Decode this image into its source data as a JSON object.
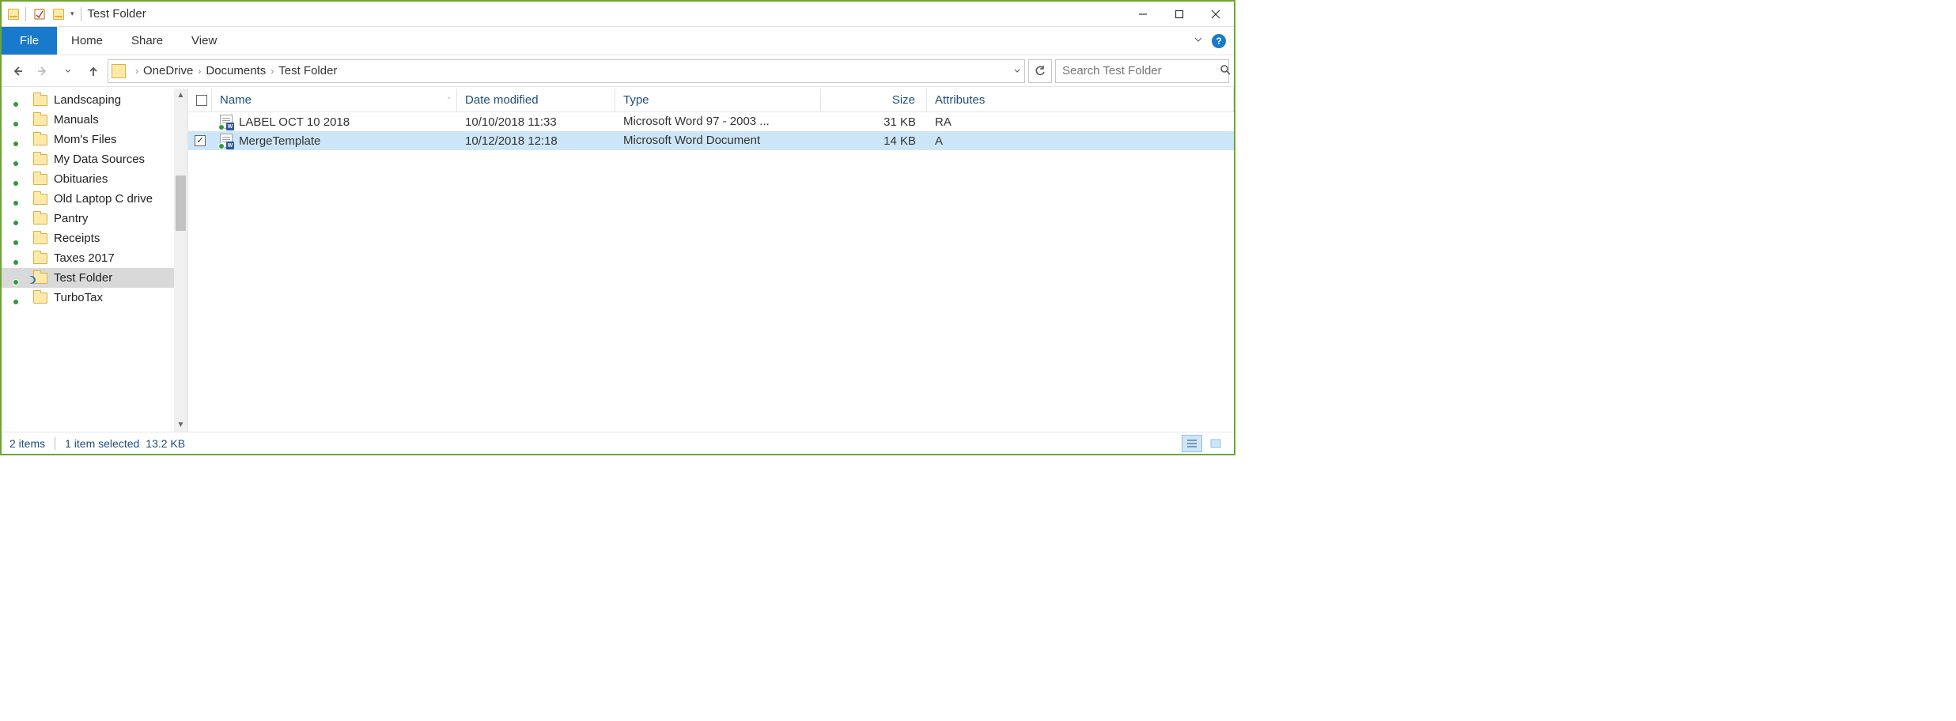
{
  "window": {
    "title": "Test Folder"
  },
  "ribbon": {
    "file": "File",
    "tabs": [
      "Home",
      "Share",
      "View"
    ]
  },
  "breadcrumbs": [
    "OneDrive",
    "Documents",
    "Test Folder"
  ],
  "search": {
    "placeholder": "Search Test Folder"
  },
  "sidebar": {
    "items": [
      "Landscaping",
      "Manuals",
      "Mom's Files",
      "My Data Sources",
      "Obituaries",
      "Old Laptop C drive",
      "Pantry",
      "Receipts",
      "Taxes 2017",
      "Test Folder",
      "TurboTax"
    ],
    "active_index": 9
  },
  "columns": {
    "name": "Name",
    "date": "Date modified",
    "type": "Type",
    "size": "Size",
    "attr": "Attributes"
  },
  "files": [
    {
      "name": "LABEL OCT 10  2018",
      "date": "10/10/2018 11:33",
      "type": "Microsoft Word 97 - 2003 ...",
      "size": "31 KB",
      "attr": "RA",
      "selected": false
    },
    {
      "name": "MergeTemplate",
      "date": "10/12/2018 12:18",
      "type": "Microsoft Word Document",
      "size": "14 KB",
      "attr": "A",
      "selected": true
    }
  ],
  "status": {
    "count": "2 items",
    "selection": "1 item selected",
    "size": "13.2 KB"
  }
}
